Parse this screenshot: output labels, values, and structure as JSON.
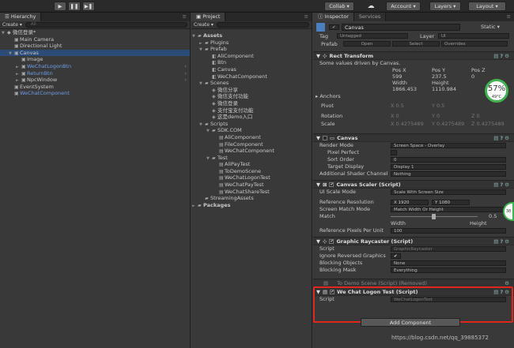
{
  "toolbar": {
    "collab": "Collab ▾",
    "account": "Account ▾",
    "layers": "Layers ▾",
    "layout": "Layout ▾"
  },
  "hierarchy": {
    "tab": "Hierarchy",
    "create": "Create ▾",
    "search": "All",
    "items": [
      {
        "label": "微信登录*",
        "indent": 0,
        "blue": false,
        "arrow": "▼",
        "sel": false
      },
      {
        "label": "Main Camera",
        "indent": 1,
        "blue": false,
        "arrow": "",
        "sel": false
      },
      {
        "label": "Directional Light",
        "indent": 1,
        "blue": false,
        "arrow": "",
        "sel": false
      },
      {
        "label": "Canvas",
        "indent": 1,
        "blue": false,
        "arrow": "▼",
        "sel": true
      },
      {
        "label": "Image",
        "indent": 2,
        "blue": false,
        "arrow": "",
        "sel": false
      },
      {
        "label": "WeChatLogonBtn",
        "indent": 2,
        "blue": true,
        "arrow": "►",
        "sel": false
      },
      {
        "label": "ReturnBtn",
        "indent": 2,
        "blue": true,
        "arrow": "►",
        "sel": false
      },
      {
        "label": "NpcWindow",
        "indent": 2,
        "blue": false,
        "arrow": "►",
        "sel": false
      },
      {
        "label": "EventSystem",
        "indent": 1,
        "blue": false,
        "arrow": "",
        "sel": false
      },
      {
        "label": "WeChatComponent",
        "indent": 1,
        "blue": true,
        "arrow": "",
        "sel": false
      }
    ]
  },
  "project": {
    "tab": "Project",
    "create": "Create ▾",
    "items": [
      {
        "label": "Assets",
        "indent": 0,
        "type": "folder",
        "arrow": "▼",
        "bold": true
      },
      {
        "label": "Plugins",
        "indent": 1,
        "type": "folder",
        "arrow": "►"
      },
      {
        "label": "Prefab",
        "indent": 1,
        "type": "folder",
        "arrow": "▼"
      },
      {
        "label": "AliComponent",
        "indent": 2,
        "type": "prefab",
        "arrow": ""
      },
      {
        "label": "Btn",
        "indent": 2,
        "type": "prefab",
        "arrow": ""
      },
      {
        "label": "Canvas",
        "indent": 2,
        "type": "prefab",
        "arrow": ""
      },
      {
        "label": "WeChatComponent",
        "indent": 2,
        "type": "prefab",
        "arrow": ""
      },
      {
        "label": "Scenes",
        "indent": 1,
        "type": "folder",
        "arrow": "▼"
      },
      {
        "label": "微信分享",
        "indent": 2,
        "type": "scene",
        "arrow": ""
      },
      {
        "label": "微信支付功能",
        "indent": 2,
        "type": "scene",
        "arrow": ""
      },
      {
        "label": "微信登录",
        "indent": 2,
        "type": "scene",
        "arrow": ""
      },
      {
        "label": "支付宝支付功能",
        "indent": 2,
        "type": "scene",
        "arrow": ""
      },
      {
        "label": "这是demo入口",
        "indent": 2,
        "type": "scene",
        "arrow": ""
      },
      {
        "label": "Scripts",
        "indent": 1,
        "type": "folder",
        "arrow": "▼"
      },
      {
        "label": "SDK.COM",
        "indent": 2,
        "type": "folder",
        "arrow": "▼"
      },
      {
        "label": "AliComponent",
        "indent": 3,
        "type": "script",
        "arrow": ""
      },
      {
        "label": "FileComponent",
        "indent": 3,
        "type": "script",
        "arrow": ""
      },
      {
        "label": "WeChatComponent",
        "indent": 3,
        "type": "script",
        "arrow": ""
      },
      {
        "label": "Test",
        "indent": 2,
        "type": "folder",
        "arrow": "▼"
      },
      {
        "label": "AliPayTest",
        "indent": 3,
        "type": "script",
        "arrow": ""
      },
      {
        "label": "ToDemoScene",
        "indent": 3,
        "type": "script",
        "arrow": ""
      },
      {
        "label": "WeChatLogonTest",
        "indent": 3,
        "type": "script",
        "arrow": ""
      },
      {
        "label": "WeChatPayTest",
        "indent": 3,
        "type": "script",
        "arrow": ""
      },
      {
        "label": "WeChatShareTest",
        "indent": 3,
        "type": "script",
        "arrow": ""
      },
      {
        "label": "StreamingAssets",
        "indent": 1,
        "type": "folder",
        "arrow": ""
      },
      {
        "label": "Packages",
        "indent": 0,
        "type": "folder",
        "arrow": "►",
        "bold": true
      }
    ]
  },
  "inspector": {
    "tab1": "Inspector",
    "tab2": "Services",
    "name": "Canvas",
    "static": "Static ▾",
    "tag_label": "Tag",
    "tag": "Untagged",
    "layer_label": "Layer",
    "layer": "UI",
    "prefab_label": "Prefab",
    "open": "Open",
    "select": "Select",
    "overrides": "Overrides",
    "rect": {
      "title": "Rect Transform",
      "note": "Some values driven by Canvas.",
      "h1": "Pos X",
      "h2": "Pos Y",
      "h3": "Pos Z",
      "v1": "599",
      "v2": "237.5",
      "v3": "0",
      "h4": "Width",
      "h5": "Height",
      "v4": "1866.453",
      "v5": "1110.984",
      "anchors": "Anchors",
      "pivot": "Pivot",
      "px": "X 0.5",
      "py": "Y 0.5",
      "rotation": "Rotation",
      "rx": "X 0",
      "ry": "Y 0",
      "rz": "Z 0",
      "scale": "Scale",
      "sx": "X 0.4275489",
      "sy": "Y 0.4275489",
      "sz": "Z 0.4275489"
    },
    "canvas": {
      "title": "Canvas",
      "render_mode": "Render Mode",
      "render_mode_v": "Screen Space - Overlay",
      "pixel_perfect": "Pixel Perfect",
      "sort_order": "Sort Order",
      "sort_order_v": "0",
      "target_display": "Target Display",
      "target_display_v": "Display 1",
      "additional": "Additional Shader Channel",
      "additional_v": "Nothing"
    },
    "scaler": {
      "title": "Canvas Scaler (Script)",
      "ui_scale": "UI Scale Mode",
      "ui_scale_v": "Scale With Screen Size",
      "ref_res": "Reference Resolution",
      "ref_x": "X 1920",
      "ref_y": "Y 1080",
      "match_mode": "Screen Match Mode",
      "match_mode_v": "Match Width Or Height",
      "match": "Match",
      "match_v": "0.5",
      "width": "Width",
      "height": "Height",
      "ppu": "Reference Pixels Per Unit",
      "ppu_v": "100"
    },
    "raycaster": {
      "title": "Graphic Raycaster (Script)",
      "script": "Script",
      "script_v": "GraphicRaycaster",
      "ignore": "Ignore Reversed Graphics",
      "blocking": "Blocking Objects",
      "blocking_v": "None",
      "mask": "Blocking Mask",
      "mask_v": "Everything"
    },
    "removed": "To Demo Scene (Script) (Removed)",
    "logon": {
      "title": "We Chat Logon Test (Script)",
      "script": "Script",
      "script_v": "WeChatLogonTest"
    },
    "add": "Add Component"
  },
  "gauge": {
    "pct": "57%",
    "temp": "49°C",
    "side": "38"
  },
  "watermark": "https://blog.csdn.net/qq_39885372"
}
